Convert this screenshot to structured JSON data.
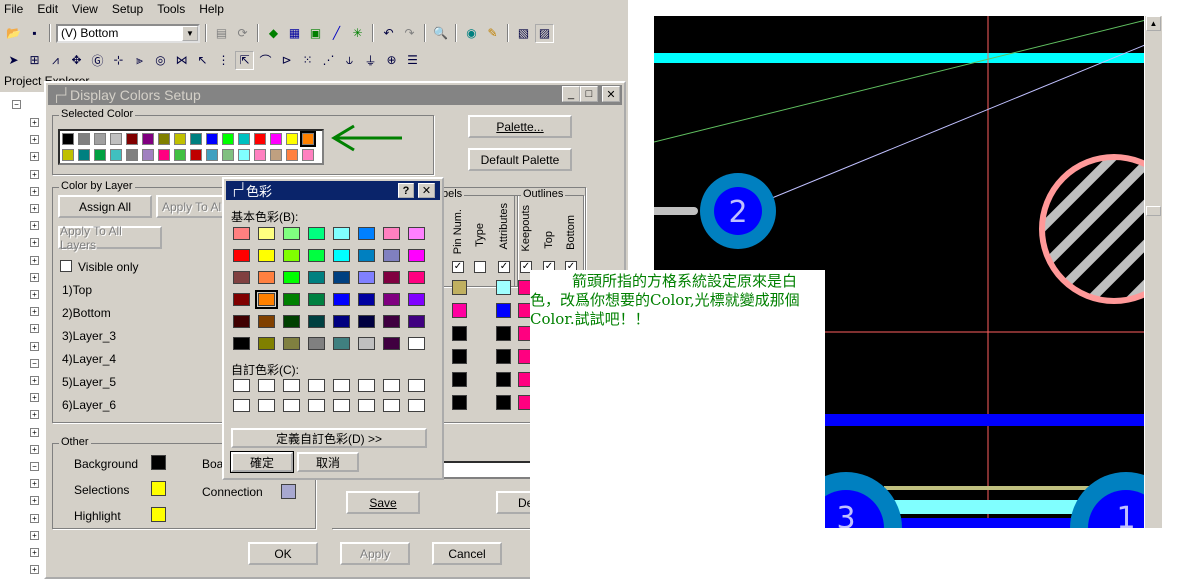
{
  "menu": [
    "File",
    "Edit",
    "View",
    "Setup",
    "Tools",
    "Help"
  ],
  "toolbar": {
    "layer_value": "(V) Bottom"
  },
  "project_panel": {
    "title": "Project Explorer"
  },
  "dialog": {
    "title": "Display Colors Setup",
    "selected_color_label": "Selected Color",
    "palette_button": "Palette...",
    "default_palette_button": "Default Palette",
    "color_by_layer_label": "Color by Layer",
    "assign_all_button": "Assign All",
    "apply_to_all_button": "Apply To All",
    "apply_to_all_layers_button": "Apply To All Layers",
    "visible_only_label": "Visible only",
    "layers": [
      "1)Top",
      "2)Bottom",
      "3)Layer_3",
      "4)Layer_4",
      "5)Layer_5",
      "6)Layer_6"
    ],
    "labels_group_label": "bels",
    "outlines_group_label": "Outlines",
    "column_headers": [
      "Pin Num.",
      "Type",
      "Attributes",
      "Keepouts",
      "Top",
      "Bottom"
    ],
    "other_label": "Other",
    "background_label": "Background",
    "selections_label": "Selections",
    "highlight_label": "Highlight",
    "board_label": "Boa",
    "connection_label": "Connection",
    "save_button": "Save",
    "de_button": "De",
    "ok_button": "OK",
    "apply_button": "Apply",
    "cancel_button": "Cancel",
    "selected_row1": [
      "#000000",
      "#808080",
      "#a0a0a0",
      "#c0c0c0",
      "#800000",
      "#800080",
      "#808000",
      "#c0c000",
      "#008080",
      "#0000ff",
      "#00ff00",
      "#00c0c0",
      "#ff0000",
      "#ff00ff",
      "#ffff00",
      "#ff8000"
    ],
    "selected_row2": [
      "#c0c000",
      "#008080",
      "#00a040",
      "#40c0c0",
      "#808080",
      "#a080c0",
      "#ff0080",
      "#40c040",
      "#c00000",
      "#40a0c0",
      "#80c080",
      "#80ffff",
      "#ff80c0",
      "#c0a080",
      "#ff8040",
      "#ff80c0"
    ]
  },
  "color_dialog": {
    "title": "色彩",
    "help_button": "?",
    "close_button": "✕",
    "basic_colors_label": "基本色彩(B):",
    "custom_colors_label": "自訂色彩(C):",
    "define_custom_button": "定義自訂色彩(D) >>",
    "ok_button": "確定",
    "cancel_button": "取消",
    "basic_colors": [
      [
        "#ff8080",
        "#ffff80",
        "#80ff80",
        "#00ff80",
        "#80ffff",
        "#0080ff",
        "#ff80c0",
        "#ff80ff"
      ],
      [
        "#ff0000",
        "#ffff00",
        "#80ff00",
        "#00ff40",
        "#00ffff",
        "#0080c0",
        "#8080c0",
        "#ff00ff"
      ],
      [
        "#804040",
        "#ff8040",
        "#00ff00",
        "#008080",
        "#004080",
        "#8080ff",
        "#800040",
        "#ff0080"
      ],
      [
        "#800000",
        "#ff8000",
        "#008000",
        "#008040",
        "#0000ff",
        "#0000a0",
        "#800080",
        "#8000ff"
      ],
      [
        "#400000",
        "#804000",
        "#004000",
        "#004040",
        "#000080",
        "#000040",
        "#400040",
        "#400080"
      ],
      [
        "#000000",
        "#808000",
        "#808040",
        "#808080",
        "#408080",
        "#c0c0c0",
        "#400040",
        "#ffffff"
      ]
    ]
  },
  "annotation": {
    "text": "箭頭所指的方格系統設定原來是白色，改爲你想要的Color,光標就變成那個Color.試試吧！！"
  },
  "pcb": {
    "pad_2_label": "2",
    "pad_3_label": "3",
    "pad_1_label": "1"
  },
  "colors": {
    "title_inactive": "#848484",
    "title_active": "#0a246a",
    "arrow": "#008000",
    "trace_cyan": "#00ffff",
    "trace_blue": "#0000ff",
    "pad": "#0080c0",
    "pad_ring": "#ff9999"
  }
}
